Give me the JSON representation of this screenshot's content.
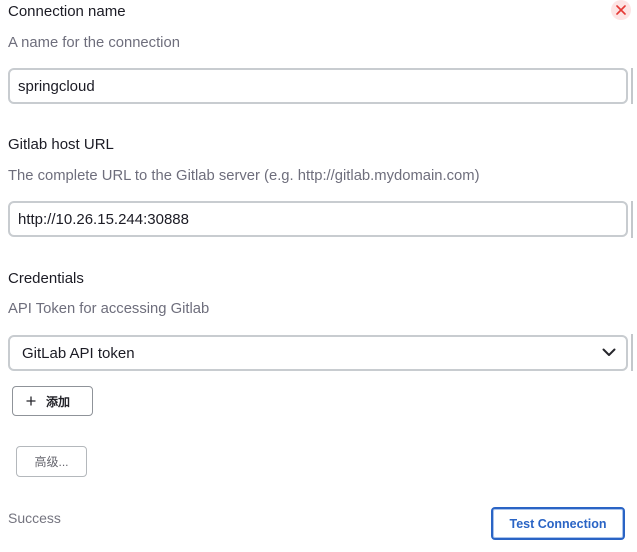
{
  "form": {
    "close_icon": "close-icon",
    "connection_name": {
      "label": "Connection name",
      "description": "A name for the connection",
      "value": "springcloud"
    },
    "gitlab_host_url": {
      "label": "Gitlab host URL",
      "description": "The complete URL to the Gitlab server (e.g. http://gitlab.mydomain.com)",
      "value": "http://10.26.15.244:30888"
    },
    "credentials": {
      "label": "Credentials",
      "description": "API Token for accessing Gitlab",
      "selected": "GitLab API token",
      "dropdown_icon": "chevron-down-icon",
      "add_button": {
        "icon": "plus-icon",
        "label": "添加"
      }
    },
    "advanced_button": {
      "label": "高级..."
    },
    "test_status": "Success",
    "test_connection_button": {
      "label": "Test Connection"
    }
  },
  "colors": {
    "accent": "#2a64c5",
    "danger": "#e53935",
    "danger_bg": "#fde4e4"
  }
}
